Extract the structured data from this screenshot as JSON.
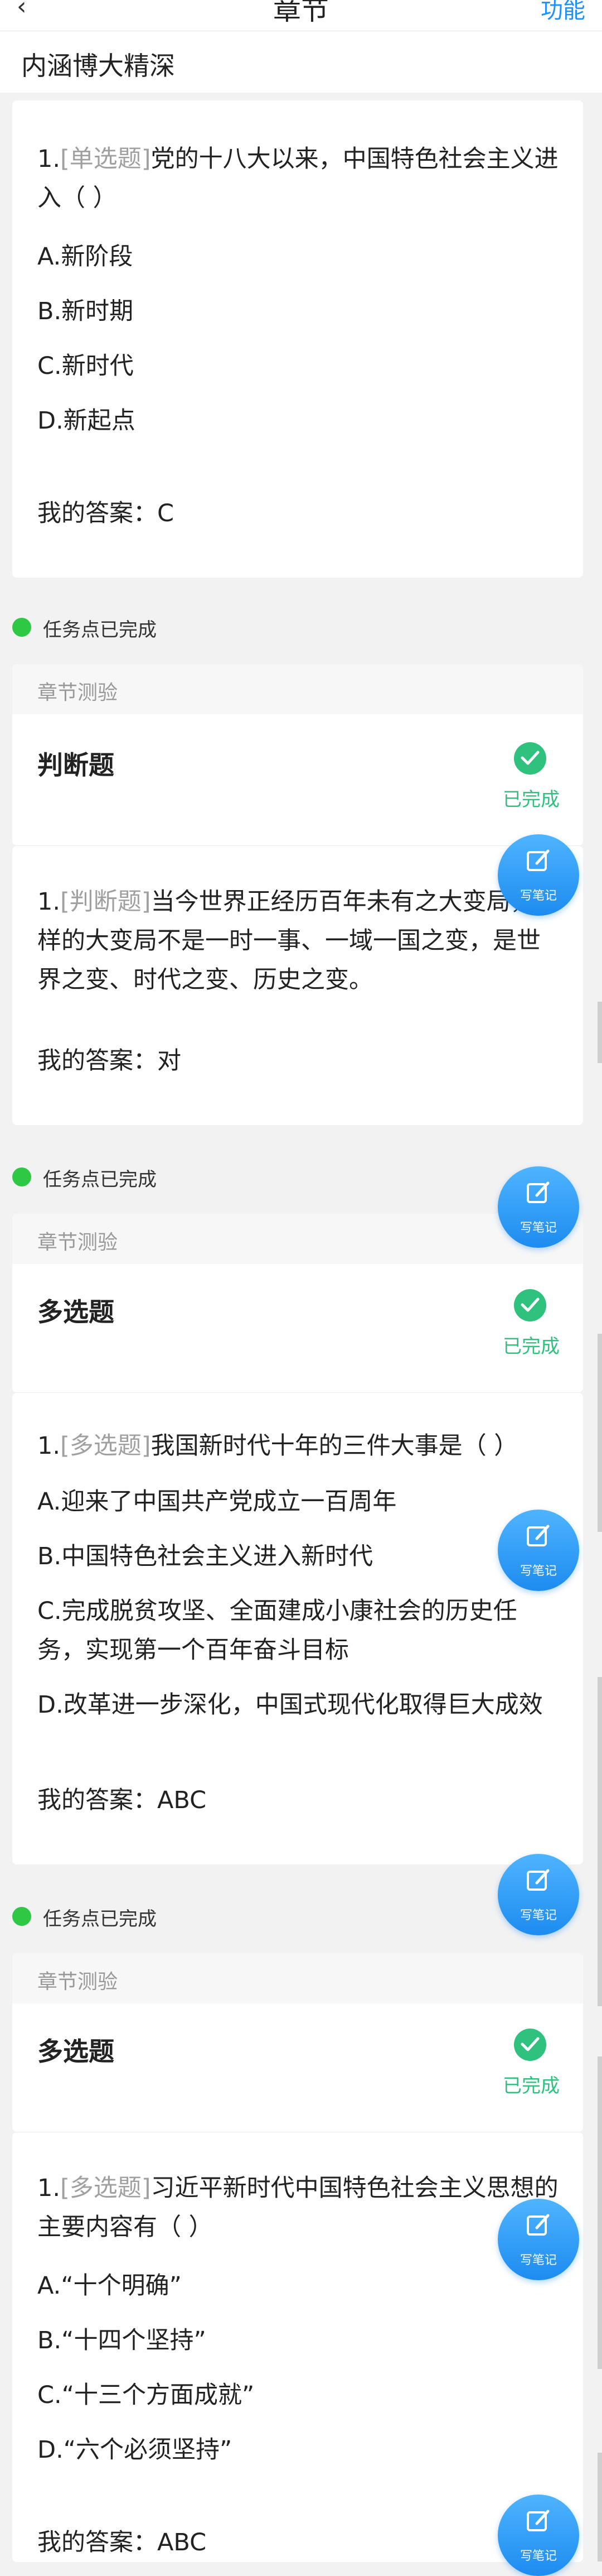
{
  "header": {
    "back_icon": "chevron-left-icon",
    "title": "章节",
    "right": "功能"
  },
  "section_title": "内涵博大精深",
  "colors": {
    "accent": "#1e90ff",
    "success": "#2ec27e",
    "task_dot": "#2ec845"
  },
  "task_done_label": "任务点已完成",
  "chapter_test_label": "章节测验",
  "done_label": "已完成",
  "note_label": "写笔记",
  "q1": {
    "number": "1.",
    "type": "[单选题]",
    "line1": "党的十八大以来，中国特色社会主义进",
    "line2": "入（    ）",
    "options": [
      "A.新阶段",
      "B.新时期",
      "C.新时代",
      "D.新起点"
    ],
    "answer": "我的答案：C"
  },
  "card2": {
    "title": "判断题",
    "number": "1.",
    "type": "[判断题]",
    "line1": "当今世界正经历百年未有之大变局，",
    "line2": "样的大变局不是一时一事、一域一国之变，是世",
    "line3": "界之变、时代之变、历史之变。",
    "answer": "我的答案：对"
  },
  "card3": {
    "title": "多选题",
    "number": "1.",
    "type": "[多选题]",
    "line1": "我国新时代十年的三件大事是（    ）",
    "options": [
      "A.迎来了中国共产党成立一百周年",
      "B.中国特色社会主义进入新时代",
      "C.完成脱贫攻坚、全面建成小康社会的历史任",
      "务，实现第一个百年奋斗目标",
      "D.改革进一步深化，中国式现代化取得巨大成效"
    ],
    "answer": "我的答案：ABC"
  },
  "card4": {
    "title": "多选题",
    "number": "1.",
    "type": "[多选题]",
    "line1": "习近平新时代中国特色社会主义思想的",
    "line2": "主要内容有（    ）",
    "options": [
      "A.“十个明确”",
      "B.“十四个坚持”",
      "C.“十三个方面成就”",
      "D.“六个必须坚持”"
    ],
    "answer": "我的答案：ABC"
  }
}
